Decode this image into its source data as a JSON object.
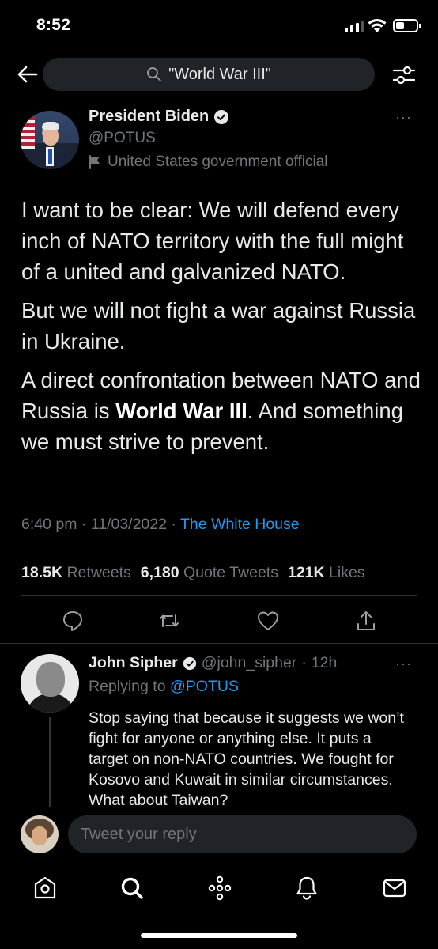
{
  "status_bar": {
    "time": "8:52",
    "signal_bars": 4,
    "signal_bars_filled": 3,
    "battery_level": 0.4,
    "icons": [
      "signal-icon",
      "wifi-icon",
      "battery-icon"
    ]
  },
  "search": {
    "query": "\"World War III\"",
    "back_icon": "arrow-left-icon",
    "filter_icon": "sliders-icon",
    "search_icon": "search-icon"
  },
  "tweet": {
    "author_name": "President Biden",
    "author_handle": "@POTUS",
    "verified": true,
    "label": "United States government official",
    "paragraphs": [
      "I want to be clear: We will defend every inch of NATO territory with the full might of a united and galvanized NATO.",
      "But we will not fight a war against Russia in Ukraine."
    ],
    "para3_before": "A direct confrontation between NATO and Russia is ",
    "para3_bold": "World War III",
    "para3_after": ". And something we must strive to prevent.",
    "time": "6:40 pm",
    "date": "11/03/2022",
    "source": "The White House",
    "separator": "·",
    "stats": {
      "retweets_count": "18.5K",
      "retweets_label": "Retweets",
      "quotes_count": "6,180",
      "quotes_label": "Quote Tweets",
      "likes_count": "121K",
      "likes_label": "Likes"
    },
    "more": "···"
  },
  "reply": {
    "author_name": "John Sipher",
    "author_handle": "@john_sipher",
    "age": "12h",
    "separator": "·",
    "replying_prefix": "Replying to",
    "replying_to": "@POTUS",
    "text": "Stop saying that because it suggests we won’t fight for anyone or anything else. It puts a target on non-NATO countries. We fought for Kosovo and Kuwait in similar circumstances. What about Taiwan?",
    "more": "···"
  },
  "compose": {
    "placeholder": "Tweet your reply"
  },
  "tabbar": {
    "tabs": [
      "home-icon",
      "search-icon",
      "spaces-icon",
      "notifications-icon",
      "messages-icon"
    ]
  },
  "colors": {
    "background": "#000000",
    "accent": "#1d9bf0",
    "secondary_text": "#71767b",
    "primary_text": "#e7e9ea"
  }
}
